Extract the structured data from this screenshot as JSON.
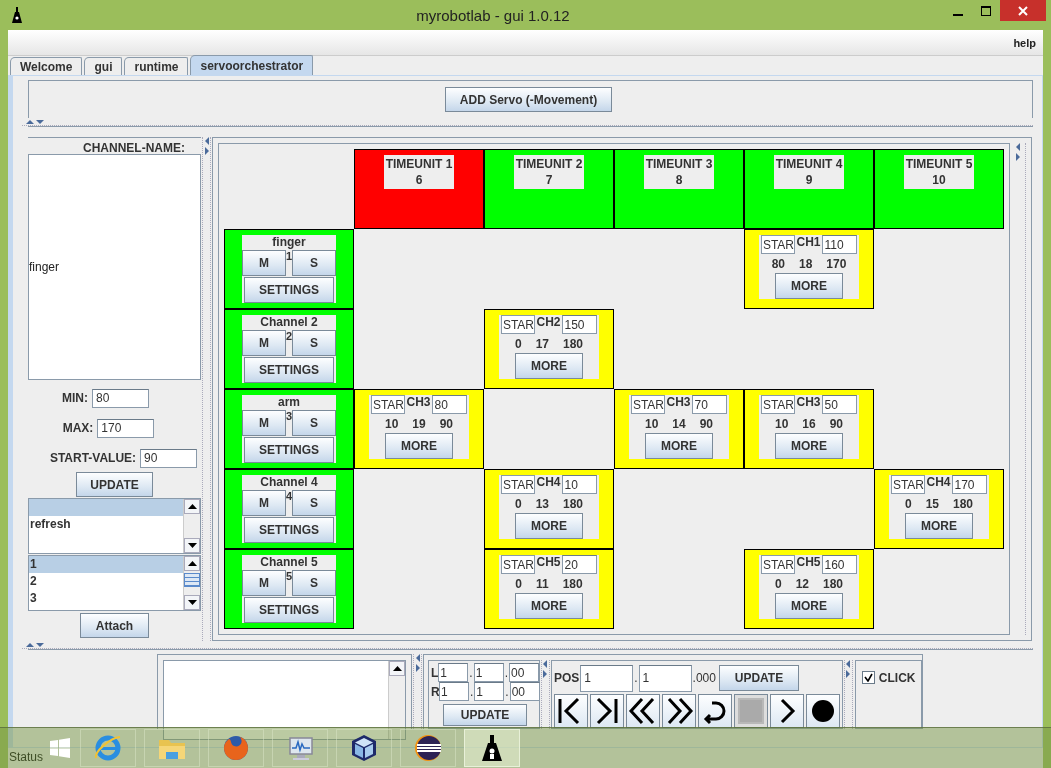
{
  "window": {
    "title": "myrobotlab - gui 1.0.12"
  },
  "menu": [
    {
      "label": "help"
    }
  ],
  "tabs": [
    {
      "label": "Welcome",
      "selected": false
    },
    {
      "label": "gui",
      "selected": false
    },
    {
      "label": "runtime",
      "selected": false
    },
    {
      "label": "servoorchestrator",
      "selected": true
    }
  ],
  "add_button": "ADD Servo (-Movement)",
  "channel_panel": {
    "heading": "CHANNEL-NAME:",
    "name": "finger",
    "fields": [
      {
        "label": "MIN:",
        "value": "80"
      },
      {
        "label": "MAX:",
        "value": "170"
      },
      {
        "label": "START-VALUE:",
        "value": "90"
      }
    ],
    "update_button": "UPDATE",
    "methods_list": [
      {
        "selected": true
      },
      {
        "label": "refresh",
        "selected": false
      }
    ],
    "index_list": [
      {
        "label": "1",
        "selected": true
      },
      {
        "label": "2",
        "selected": false
      },
      {
        "label": "3",
        "selected": false
      }
    ],
    "attach_button": "Attach"
  },
  "timeline": {
    "timeunits": [
      {
        "label": "TIMEUNIT 1",
        "value": "6",
        "active": true
      },
      {
        "label": "TIMEUNIT 2",
        "value": "7",
        "active": false
      },
      {
        "label": "TIMEUNIT 3",
        "value": "8",
        "active": false
      },
      {
        "label": "TIMEUNIT 4",
        "value": "9",
        "active": false
      },
      {
        "label": "TIMEUNIT 5",
        "value": "10",
        "active": false
      }
    ],
    "channels": [
      {
        "name": "finger",
        "number": "1",
        "mute": "M",
        "solo": "S",
        "settings": "SETTINGS",
        "cells": [
          {
            "kind": "empty"
          },
          {
            "kind": "empty"
          },
          {
            "kind": "empty"
          },
          {
            "kind": "step",
            "star": "STAR",
            "channel": "CH1",
            "value": "110",
            "min": "80",
            "speed": "18",
            "max": "170",
            "more": "MORE"
          },
          {
            "kind": "empty"
          }
        ]
      },
      {
        "name": "Channel 2",
        "number": "2",
        "mute": "M",
        "solo": "S",
        "settings": "SETTINGS",
        "cells": [
          {
            "kind": "empty"
          },
          {
            "kind": "step",
            "star": "STAR",
            "channel": "CH2",
            "value": "150",
            "min": "0",
            "speed": "17",
            "max": "180",
            "more": "MORE"
          },
          {
            "kind": "empty"
          },
          {
            "kind": "empty"
          },
          {
            "kind": "empty"
          }
        ]
      },
      {
        "name": "arm",
        "number": "3",
        "mute": "M",
        "solo": "S",
        "settings": "SETTINGS",
        "cells": [
          {
            "kind": "step",
            "star": "STAR",
            "channel": "CH3",
            "value": "80",
            "min": "10",
            "speed": "19",
            "max": "90",
            "more": "MORE"
          },
          {
            "kind": "empty"
          },
          {
            "kind": "step",
            "star": "STAR",
            "channel": "CH3",
            "value": "70",
            "min": "10",
            "speed": "14",
            "max": "90",
            "more": "MORE"
          },
          {
            "kind": "step",
            "star": "STAR",
            "channel": "CH3",
            "value": "50",
            "min": "10",
            "speed": "16",
            "max": "90",
            "more": "MORE"
          },
          {
            "kind": "empty"
          }
        ]
      },
      {
        "name": "Channel 4",
        "number": "4",
        "mute": "M",
        "solo": "S",
        "settings": "SETTINGS",
        "cells": [
          {
            "kind": "empty"
          },
          {
            "kind": "step",
            "star": "STAR",
            "channel": "CH4",
            "value": "10",
            "min": "0",
            "speed": "13",
            "max": "180",
            "more": "MORE"
          },
          {
            "kind": "empty"
          },
          {
            "kind": "empty"
          },
          {
            "kind": "step",
            "star": "STAR",
            "channel": "CH4",
            "value": "170",
            "min": "0",
            "speed": "15",
            "max": "180",
            "more": "MORE"
          }
        ]
      },
      {
        "name": "Channel 5",
        "number": "5",
        "mute": "M",
        "solo": "S",
        "settings": "SETTINGS",
        "cells": [
          {
            "kind": "empty"
          },
          {
            "kind": "step",
            "star": "STAR",
            "channel": "CH5",
            "value": "20",
            "min": "0",
            "speed": "11",
            "max": "180",
            "more": "MORE"
          },
          {
            "kind": "empty"
          },
          {
            "kind": "step",
            "star": "STAR",
            "channel": "CH5",
            "value": "160",
            "min": "0",
            "speed": "12",
            "max": "180",
            "more": "MORE"
          },
          {
            "kind": "empty"
          }
        ]
      }
    ]
  },
  "position": {
    "rows": [
      {
        "label": "L",
        "parts": [
          "1",
          ".",
          "1",
          ".",
          "00"
        ]
      },
      {
        "label": "R",
        "parts": [
          "1",
          ".",
          "1",
          ".",
          "00"
        ]
      }
    ],
    "update_button": "UPDATE",
    "pos_label": "POS",
    "pos_parts": [
      "1",
      ".",
      "1",
      ".000"
    ],
    "pos_update": "UPDATE",
    "transport": [
      {
        "kind": "first",
        "disabled": false
      },
      {
        "kind": "last",
        "disabled": false
      },
      {
        "kind": "rewind",
        "disabled": false
      },
      {
        "kind": "forward",
        "disabled": false
      },
      {
        "kind": "loop",
        "disabled": false
      },
      {
        "kind": "stop",
        "disabled": true
      },
      {
        "kind": "play",
        "disabled": false
      },
      {
        "kind": "record",
        "disabled": false
      }
    ],
    "click": {
      "label": "CLICK",
      "checked": true
    }
  },
  "status_bar": "Status",
  "taskbar": [
    {
      "kind": "ie",
      "active": false
    },
    {
      "kind": "folder",
      "active": false
    },
    {
      "kind": "firefox",
      "active": false
    },
    {
      "kind": "monitor",
      "active": false
    },
    {
      "kind": "cube",
      "active": false
    },
    {
      "kind": "eclipse",
      "active": false
    },
    {
      "kind": "flask",
      "active": true
    }
  ]
}
